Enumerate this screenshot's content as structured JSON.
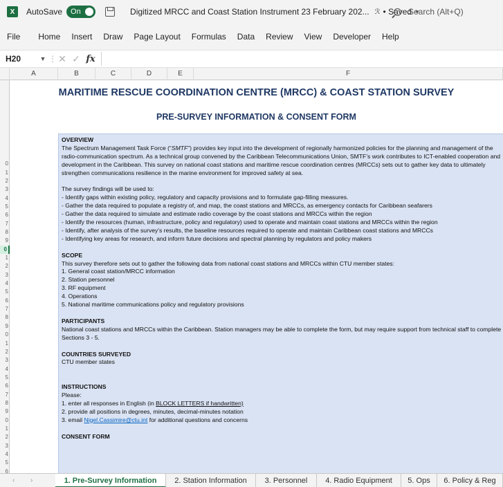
{
  "titlebar": {
    "app_icon": "X",
    "autosave_label": "AutoSave",
    "autosave_state": "On",
    "document_title": "Digitized MRCC and Coast Station Instrument 23 February 202...",
    "saved_label": "• Saved",
    "search_placeholder": "Search (Alt+Q)"
  },
  "menu": [
    "File",
    "Home",
    "Insert",
    "Draw",
    "Page Layout",
    "Formulas",
    "Data",
    "Review",
    "View",
    "Developer",
    "Help"
  ],
  "formula_bar": {
    "cell_ref": "H20",
    "fx_label": "fx",
    "value": ""
  },
  "columns": [
    "A",
    "B",
    "C",
    "D",
    "E",
    "F"
  ],
  "row_numbers": [
    "",
    "",
    "",
    "",
    "",
    "",
    "",
    "",
    "",
    "0",
    "1",
    "2",
    "3",
    "4",
    "5",
    "6",
    "7",
    "8",
    "9",
    "0",
    "1",
    "2",
    "3",
    "4",
    "5",
    "6",
    "7",
    "8",
    "9",
    "0",
    "1",
    "2",
    "3",
    "4",
    "5",
    "6",
    "7",
    "8",
    "9",
    "0",
    "1",
    "2",
    "3",
    "4",
    "5",
    "6"
  ],
  "sheet": {
    "title": "MARITIME RESCUE COORDINATION CENTRE (MRCC) & COAST STATION SURVEY",
    "subtitle": "PRE-SURVEY INFORMATION & CONSENT FORM",
    "overview_head": "OVERVIEW",
    "overview_pre": "The Spectrum Management Task Force (“",
    "overview_em": "SMTF",
    "overview_post": "”) provides key input into the development of regionally harmonized policies for the planning and management of the radio-communication spectrum. As a technical group convened by the Caribbean Telecommunications Union, SMTF’s work contributes to ICT-enabled cooperation and development in the Caribbean. This survey on national coast stations and maritime rescue coordination centres (MRCCs) sets out to gather key data to ultimately strengthen communications resilience in the marine environment for improved safety at sea.",
    "findings_intro": "The survey findings will be used to:",
    "findings": [
      "- Identify gaps within existing policy, regulatory and capacity provisions and to formulate gap-filling measures.",
      "- Gather the data required to populate a registry of, and map, the coast stations and MRCCs, as emergency contacts for Caribbean seafarers",
      "- Gather the data required to simulate and estimate radio coverage by the coast stations and MRCCs within the region",
      "- Identify the resources (human, infrastructure, policy and regulatory) used to operate and maintain coast stations and MRCCs within the region",
      "- Identify, after analysis of the survey's results, the baseline resources required to operate and maintain Caribbean coast stations and MRCCs",
      "- Identifying key areas for research, and inform future decisions and spectral planning by regulators and policy makers"
    ],
    "scope_head": "SCOPE",
    "scope_intro": "This survey therefore sets out to gather the following data from national coast stations and MRCCs within CTU member states:",
    "scope_items": [
      "1. General coast station/MRCC information",
      "2. Station personnel",
      "3. RF equipment",
      "4. Operations",
      "5. National maritime communications policy and regulatory provisions"
    ],
    "participants_head": "PARTICIPANTS",
    "participants_text": "National coast stations and MRCCs within the Caribbean. Station managers may be able to complete the form, but may require support from technical staff to complete Sections 3 - 5.",
    "countries_head": "COUNTRIES SURVEYED",
    "countries_text": "CTU member states",
    "instructions_head": "INSTRUCTIONS",
    "instructions_please": "Please:",
    "instr1_pre": "1. enter all responses in English (in ",
    "instr1_u": "BLOCK LETTERS if handwritten)",
    "instr2": "2. provide all positions in degrees, minutes, decimal-minutes notation",
    "instr3_pre": "3. email ",
    "instr3_link": "Nigel.Cassimire@ctu.int",
    "instr3_post": " for additional questions and concerns",
    "consent_head": "CONSENT FORM"
  },
  "tabs": [
    "1. Pre-Survey Information",
    "2. Station Information",
    "3. Personnel",
    "4. Radio Equipment",
    "5. Ops",
    "6. Policy & Reg"
  ],
  "tab_nav": {
    "prev": "‹",
    "next": "›"
  }
}
